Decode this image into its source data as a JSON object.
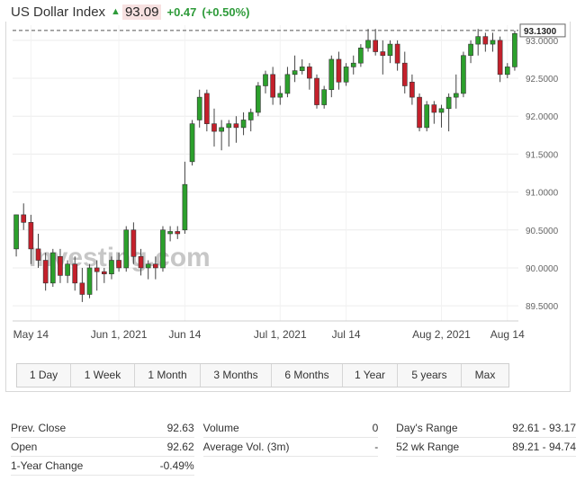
{
  "header": {
    "title": "US Dollar Index",
    "price": "93.09",
    "change": "+0.47",
    "change_pct": "(+0.50%)"
  },
  "colors": {
    "up": "#2ca02c",
    "down": "#c4202b",
    "accent_green": "#2e9b3a",
    "price_bg": "#f7e1e1"
  },
  "watermark": "Investing.com",
  "chart_data": {
    "type": "candlestick",
    "last_price_label": "93.1300",
    "ylim": [
      89.3,
      93.2
    ],
    "yticks": [
      "93.0000",
      "92.5000",
      "92.0000",
      "91.5000",
      "91.0000",
      "90.5000",
      "90.0000",
      "89.5000"
    ],
    "ytick_values": [
      93.0,
      92.5,
      92.0,
      91.5,
      91.0,
      90.5,
      90.0,
      89.5
    ],
    "xticks": [
      {
        "label": "May 14",
        "index": 2
      },
      {
        "label": "Jun 1, 2021",
        "index": 14
      },
      {
        "label": "Jun 14",
        "index": 23
      },
      {
        "label": "Jul 1, 2021",
        "index": 36
      },
      {
        "label": "Jul 14",
        "index": 45
      },
      {
        "label": "Aug 2, 2021",
        "index": 58
      },
      {
        "label": "Aug 14",
        "index": 67
      }
    ],
    "grid": true,
    "candles": [
      {
        "o": 90.25,
        "h": 90.7,
        "l": 90.15,
        "c": 90.7
      },
      {
        "o": 90.7,
        "h": 90.85,
        "l": 90.5,
        "c": 90.6
      },
      {
        "o": 90.6,
        "h": 90.7,
        "l": 90.05,
        "c": 90.25
      },
      {
        "o": 90.25,
        "h": 90.45,
        "l": 90.0,
        "c": 90.1
      },
      {
        "o": 90.1,
        "h": 90.2,
        "l": 89.7,
        "c": 89.8
      },
      {
        "o": 89.8,
        "h": 90.25,
        "l": 89.75,
        "c": 90.2
      },
      {
        "o": 90.15,
        "h": 90.25,
        "l": 89.8,
        "c": 89.9
      },
      {
        "o": 89.9,
        "h": 90.1,
        "l": 89.8,
        "c": 90.05
      },
      {
        "o": 90.05,
        "h": 90.15,
        "l": 89.7,
        "c": 89.8
      },
      {
        "o": 89.8,
        "h": 90.0,
        "l": 89.55,
        "c": 89.65
      },
      {
        "o": 89.65,
        "h": 90.05,
        "l": 89.6,
        "c": 90.0
      },
      {
        "o": 90.0,
        "h": 90.1,
        "l": 89.7,
        "c": 89.95
      },
      {
        "o": 89.95,
        "h": 90.0,
        "l": 89.8,
        "c": 89.92
      },
      {
        "o": 89.92,
        "h": 90.15,
        "l": 89.85,
        "c": 90.1
      },
      {
        "o": 90.1,
        "h": 90.2,
        "l": 89.95,
        "c": 90.0
      },
      {
        "o": 90.0,
        "h": 90.55,
        "l": 89.95,
        "c": 90.5
      },
      {
        "o": 90.5,
        "h": 90.6,
        "l": 90.05,
        "c": 90.15
      },
      {
        "o": 90.15,
        "h": 90.25,
        "l": 89.9,
        "c": 90.0
      },
      {
        "o": 90.0,
        "h": 90.1,
        "l": 89.85,
        "c": 90.05
      },
      {
        "o": 90.05,
        "h": 90.15,
        "l": 89.85,
        "c": 90.0
      },
      {
        "o": 90.0,
        "h": 90.55,
        "l": 89.95,
        "c": 90.5
      },
      {
        "o": 90.45,
        "h": 90.55,
        "l": 90.35,
        "c": 90.48
      },
      {
        "o": 90.48,
        "h": 90.55,
        "l": 90.38,
        "c": 90.45
      },
      {
        "o": 90.5,
        "h": 91.4,
        "l": 90.45,
        "c": 91.1
      },
      {
        "o": 91.4,
        "h": 91.95,
        "l": 91.35,
        "c": 91.9
      },
      {
        "o": 91.95,
        "h": 92.35,
        "l": 91.85,
        "c": 92.25
      },
      {
        "o": 92.3,
        "h": 92.35,
        "l": 91.8,
        "c": 91.9
      },
      {
        "o": 91.9,
        "h": 92.1,
        "l": 91.6,
        "c": 91.8
      },
      {
        "o": 91.8,
        "h": 91.95,
        "l": 91.55,
        "c": 91.85
      },
      {
        "o": 91.85,
        "h": 91.95,
        "l": 91.6,
        "c": 91.9
      },
      {
        "o": 91.9,
        "h": 92.0,
        "l": 91.65,
        "c": 91.85
      },
      {
        "o": 91.85,
        "h": 92.05,
        "l": 91.75,
        "c": 91.95
      },
      {
        "o": 91.95,
        "h": 92.1,
        "l": 91.8,
        "c": 92.05
      },
      {
        "o": 92.05,
        "h": 92.45,
        "l": 92.0,
        "c": 92.4
      },
      {
        "o": 92.4,
        "h": 92.6,
        "l": 92.3,
        "c": 92.55
      },
      {
        "o": 92.55,
        "h": 92.65,
        "l": 92.15,
        "c": 92.25
      },
      {
        "o": 92.25,
        "h": 92.4,
        "l": 92.15,
        "c": 92.3
      },
      {
        "o": 92.3,
        "h": 92.65,
        "l": 92.25,
        "c": 92.55
      },
      {
        "o": 92.55,
        "h": 92.8,
        "l": 92.45,
        "c": 92.6
      },
      {
        "o": 92.6,
        "h": 92.75,
        "l": 92.55,
        "c": 92.65
      },
      {
        "o": 92.65,
        "h": 92.7,
        "l": 92.35,
        "c": 92.5
      },
      {
        "o": 92.5,
        "h": 92.55,
        "l": 92.1,
        "c": 92.15
      },
      {
        "o": 92.15,
        "h": 92.4,
        "l": 92.1,
        "c": 92.35
      },
      {
        "o": 92.35,
        "h": 92.8,
        "l": 92.25,
        "c": 92.75
      },
      {
        "o": 92.75,
        "h": 92.85,
        "l": 92.35,
        "c": 92.45
      },
      {
        "o": 92.45,
        "h": 92.7,
        "l": 92.4,
        "c": 92.65
      },
      {
        "o": 92.65,
        "h": 92.8,
        "l": 92.55,
        "c": 92.7
      },
      {
        "o": 92.7,
        "h": 92.95,
        "l": 92.65,
        "c": 92.9
      },
      {
        "o": 92.9,
        "h": 93.15,
        "l": 92.85,
        "c": 93.0
      },
      {
        "o": 93.0,
        "h": 93.15,
        "l": 92.8,
        "c": 92.85
      },
      {
        "o": 92.85,
        "h": 93.0,
        "l": 92.55,
        "c": 92.8
      },
      {
        "o": 92.8,
        "h": 93.0,
        "l": 92.7,
        "c": 92.95
      },
      {
        "o": 92.95,
        "h": 93.0,
        "l": 92.6,
        "c": 92.7
      },
      {
        "o": 92.7,
        "h": 92.85,
        "l": 92.3,
        "c": 92.4
      },
      {
        "o": 92.45,
        "h": 92.55,
        "l": 92.15,
        "c": 92.25
      },
      {
        "o": 92.25,
        "h": 92.3,
        "l": 91.8,
        "c": 91.85
      },
      {
        "o": 91.85,
        "h": 92.2,
        "l": 91.8,
        "c": 92.15
      },
      {
        "o": 92.15,
        "h": 92.2,
        "l": 91.9,
        "c": 92.05
      },
      {
        "o": 92.05,
        "h": 92.15,
        "l": 91.85,
        "c": 92.1
      },
      {
        "o": 92.1,
        "h": 92.3,
        "l": 91.8,
        "c": 92.25
      },
      {
        "o": 92.25,
        "h": 92.55,
        "l": 92.1,
        "c": 92.3
      },
      {
        "o": 92.3,
        "h": 92.85,
        "l": 92.25,
        "c": 92.8
      },
      {
        "o": 92.8,
        "h": 93.0,
        "l": 92.7,
        "c": 92.95
      },
      {
        "o": 92.95,
        "h": 93.15,
        "l": 92.8,
        "c": 93.05
      },
      {
        "o": 93.05,
        "h": 93.1,
        "l": 92.85,
        "c": 92.95
      },
      {
        "o": 92.95,
        "h": 93.1,
        "l": 92.85,
        "c": 93.0
      },
      {
        "o": 93.0,
        "h": 93.05,
        "l": 92.45,
        "c": 92.55
      },
      {
        "o": 92.55,
        "h": 92.7,
        "l": 92.5,
        "c": 92.65
      },
      {
        "o": 92.65,
        "h": 93.13,
        "l": 92.6,
        "c": 93.09
      }
    ]
  },
  "range_buttons": [
    {
      "label": "1 Day"
    },
    {
      "label": "1 Week"
    },
    {
      "label": "1 Month"
    },
    {
      "label": "3 Months"
    },
    {
      "label": "6 Months"
    },
    {
      "label": "1 Year"
    },
    {
      "label": "5 years"
    },
    {
      "label": "Max"
    }
  ],
  "stats": {
    "prev_close": {
      "label": "Prev. Close",
      "value": "92.63"
    },
    "open": {
      "label": "Open",
      "value": "92.62"
    },
    "one_year_change": {
      "label": "1-Year Change",
      "value": "-0.49%"
    },
    "volume": {
      "label": "Volume",
      "value": "0"
    },
    "avg_volume": {
      "label": "Average Vol. (3m)",
      "value": "-"
    },
    "days_range": {
      "label": "Day's Range",
      "value": "92.61 - 93.17"
    },
    "wk52_range": {
      "label": "52 wk Range",
      "value": "89.21 - 94.74"
    }
  }
}
